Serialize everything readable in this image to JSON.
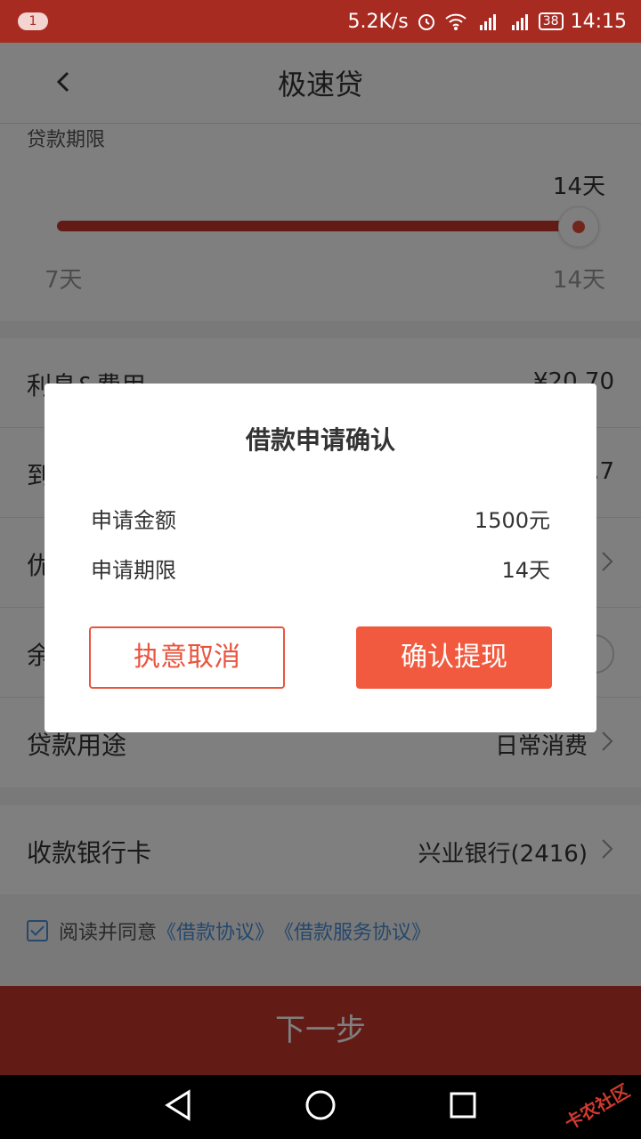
{
  "status_bar": {
    "notification_count": "1",
    "network_speed": "5.2K/s",
    "battery": "38",
    "time": "14:15"
  },
  "header": {
    "title": "极速贷"
  },
  "loan_term": {
    "label": "贷款期限",
    "current": "14天",
    "min": "7天",
    "max": "14天"
  },
  "rows": {
    "interest": {
      "label": "利息&费用",
      "value": "¥20.70"
    },
    "due": {
      "label": "到",
      "value": ".7"
    },
    "discount": {
      "label": "优"
    },
    "balance": {
      "label": "余"
    },
    "purpose": {
      "label": "贷款用途",
      "value": "日常消费"
    }
  },
  "bank": {
    "label": "收款银行卡",
    "value": "兴业银行(2416)"
  },
  "agreement": {
    "prefix": "阅读并同意",
    "link1": "《借款协议》",
    "link2": "《借款服务协议》"
  },
  "next_button": "下一步",
  "dialog": {
    "title": "借款申请确认",
    "amount_label": "申请金额",
    "amount_value": "1500元",
    "term_label": "申请期限",
    "term_value": "14天",
    "cancel": "执意取消",
    "confirm": "确认提现"
  },
  "watermark": "卡农社区"
}
